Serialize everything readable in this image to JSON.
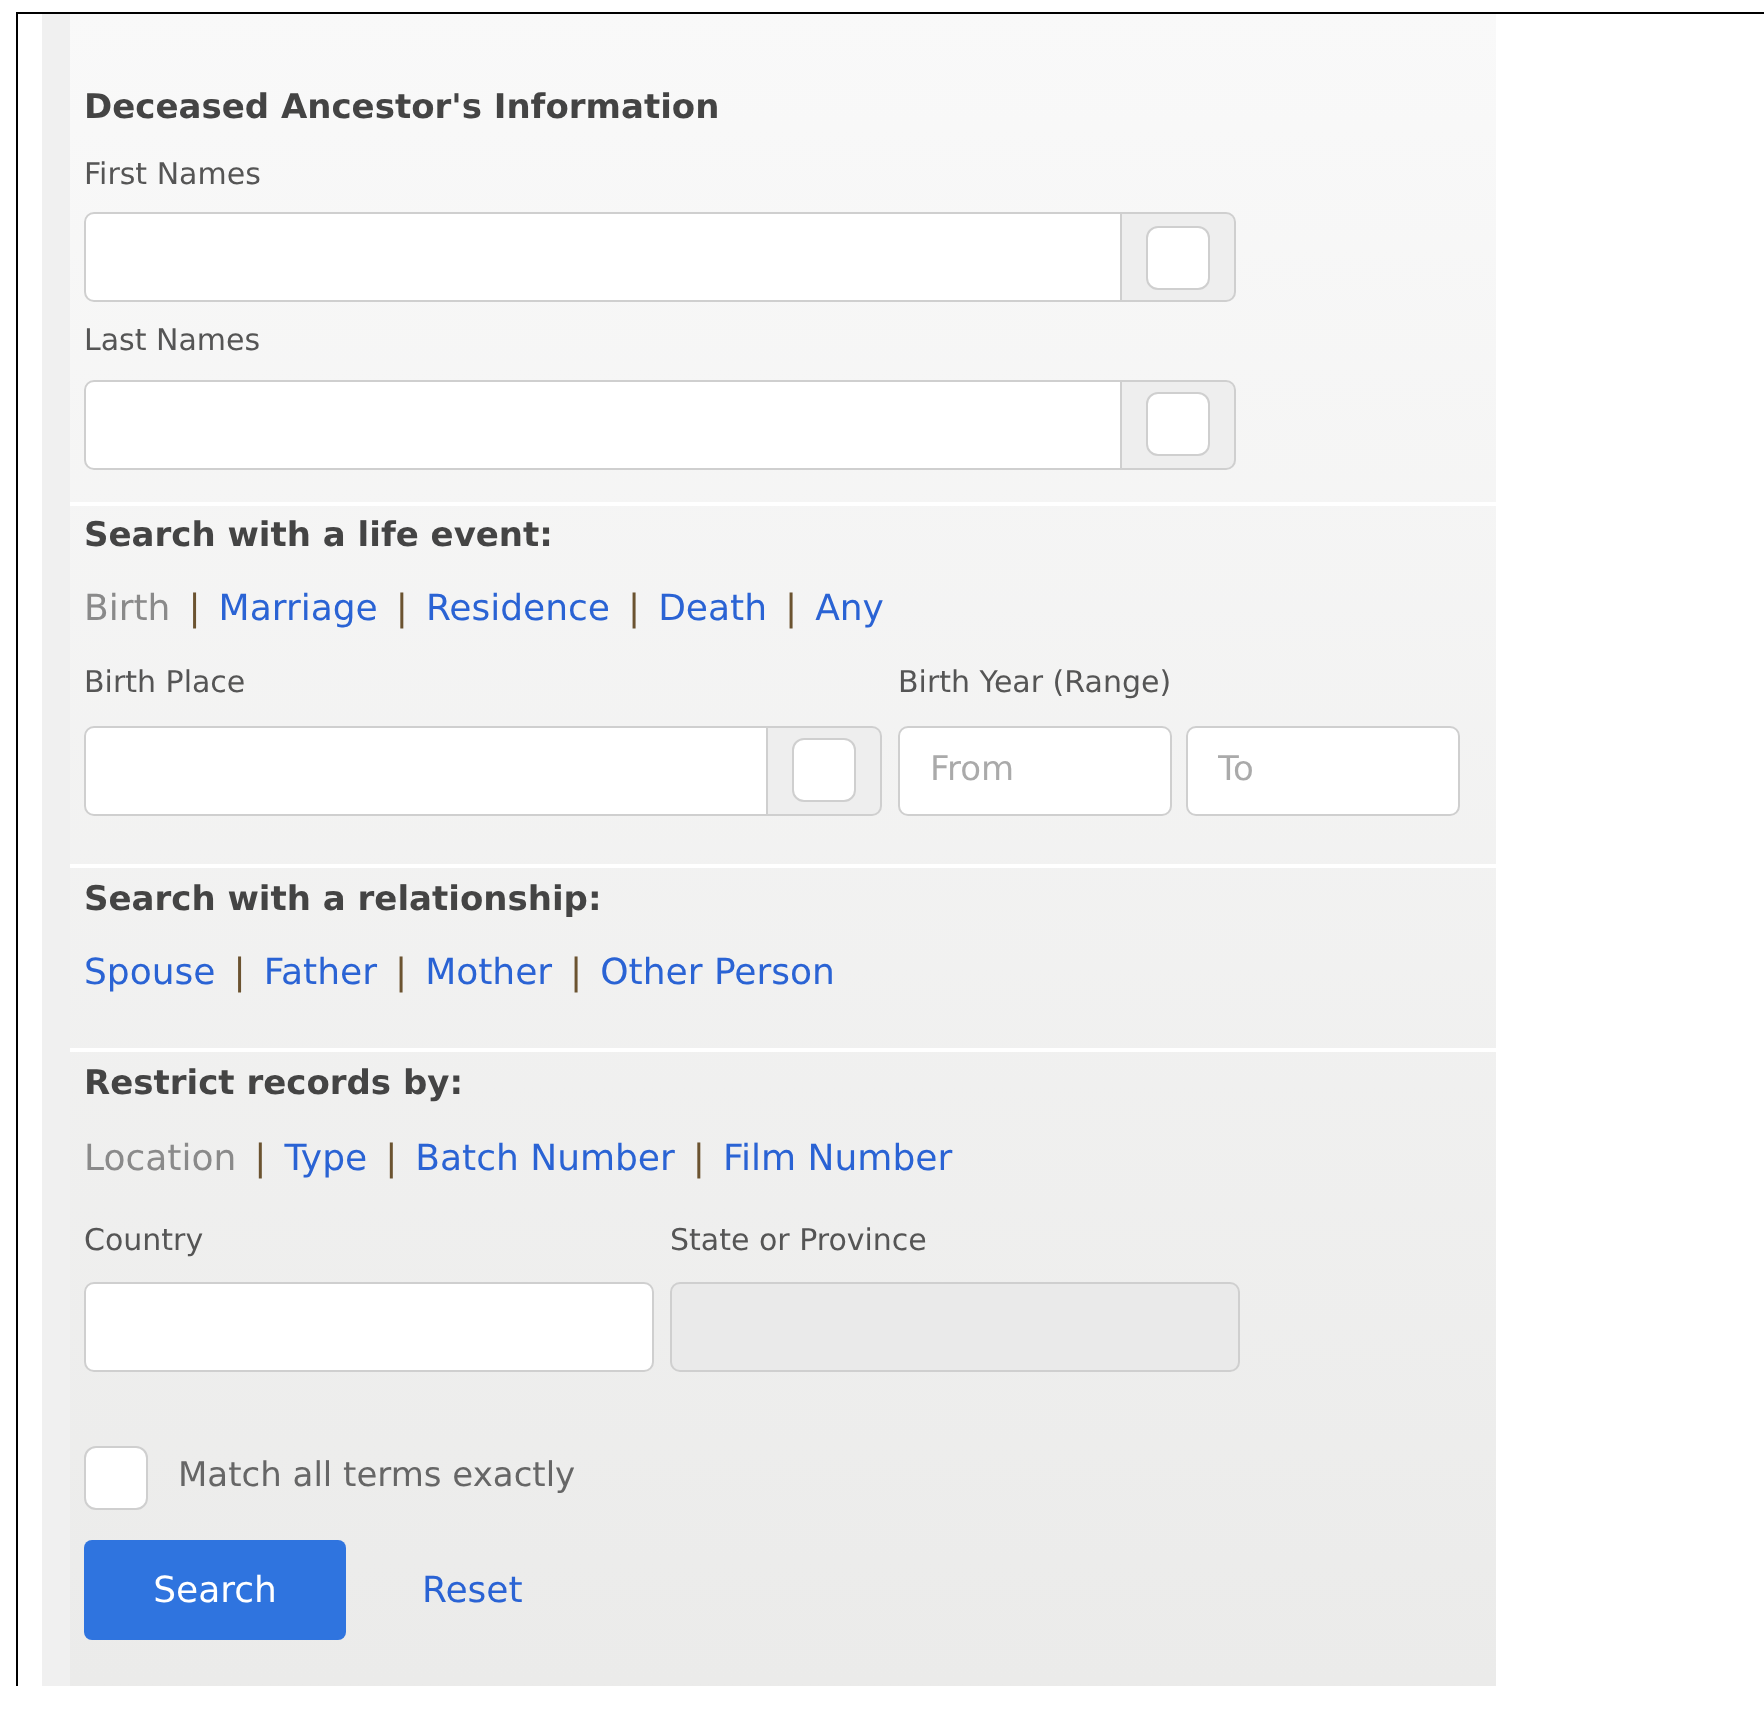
{
  "sections": [
    {
      "kind": "names",
      "title": "Deceased Ancestor's Information",
      "fields": [
        {
          "label": "First Names",
          "exact_checked": false
        },
        {
          "label": "Last Names",
          "exact_checked": false
        }
      ]
    },
    {
      "kind": "event",
      "title": "Search with a life event:",
      "links": [
        {
          "label": "Birth",
          "selected": true
        },
        {
          "separator": "|",
          "label": "Marriage",
          "selected": false
        },
        {
          "separator": "|",
          "label": "Residence",
          "selected": false
        },
        {
          "separator": "|",
          "label": "Death",
          "selected": false
        },
        {
          "separator": "|",
          "label": "Any",
          "selected": false
        }
      ],
      "place": {
        "label": "Birth Place",
        "exact_checked": false
      },
      "year": {
        "label": "Birth Year (Range)",
        "from_placeholder": "From",
        "to_placeholder": "To"
      }
    },
    {
      "kind": "relationship",
      "title": "Search with a relationship:",
      "links": [
        {
          "label": "Spouse",
          "selected": false
        },
        {
          "separator": "|",
          "label": "Father",
          "selected": false
        },
        {
          "separator": "|",
          "label": "Mother",
          "selected": false
        },
        {
          "separator": "|",
          "label": "Other Person",
          "selected": false
        }
      ]
    },
    {
      "kind": "restrict",
      "title": "Restrict records by:",
      "links": [
        {
          "label": "Location",
          "selected": true
        },
        {
          "separator": "|",
          "label": "Type",
          "selected": false
        },
        {
          "separator": "|",
          "label": "Batch Number",
          "selected": false
        },
        {
          "separator": "|",
          "label": "Film Number",
          "selected": false
        }
      ],
      "country": {
        "label": "Country",
        "disabled": false
      },
      "state": {
        "label": "State or Province",
        "disabled": true
      }
    }
  ],
  "match": {
    "label": "Match all terms exactly",
    "checked": false
  },
  "buttons": {
    "search": "Search",
    "reset": "Reset"
  }
}
